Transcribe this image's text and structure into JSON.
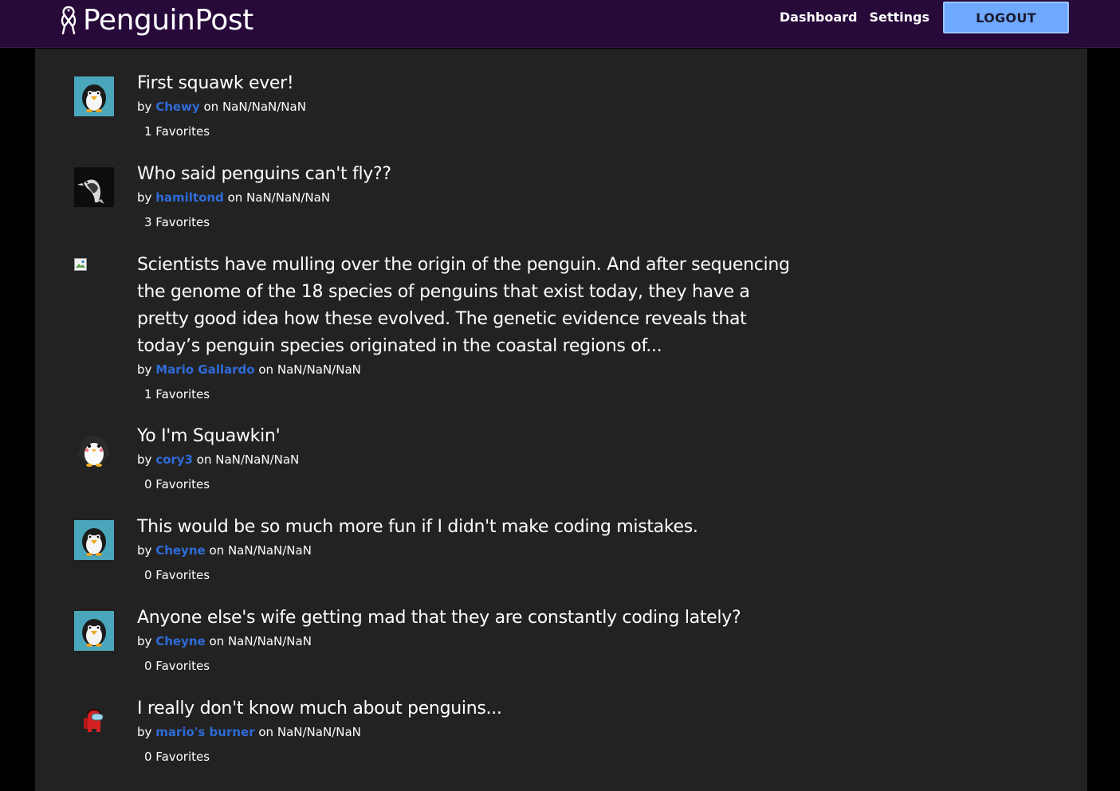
{
  "app": {
    "logo_text": "PenguinPost"
  },
  "nav": {
    "dashboard": "Dashboard",
    "settings": "Settings",
    "logout": "LOGOUT"
  },
  "posts": [
    {
      "title": "First squawk ever!",
      "by": "by",
      "author": "Chewy",
      "on": "on",
      "date": "NaN/NaN/NaN",
      "favorites": "1 Favorites",
      "avatar_icon": "penguin-avatar-icon"
    },
    {
      "title": "Who said penguins can't fly??",
      "by": "by",
      "author": "hamiltond",
      "on": "on",
      "date": "NaN/NaN/NaN",
      "favorites": "3 Favorites",
      "avatar_icon": "bird-photo-icon"
    },
    {
      "title": "Scientists have mulling over the origin of the penguin. And after sequencing the genome of the 18 species of penguins that exist today, they have a pretty good idea how these evolved. The genetic evidence reveals that today’s penguin species originated in the coastal regions of...",
      "by": "by",
      "author": "Mario Gallardo",
      "on": "on",
      "date": "NaN/NaN/NaN",
      "favorites": "1 Favorites",
      "avatar_icon": "broken-image-icon"
    },
    {
      "title": "Yo I'm Squawkin'",
      "by": "by",
      "author": "cory3",
      "on": "on",
      "date": "NaN/NaN/NaN",
      "favorites": "0 Favorites",
      "avatar_icon": "penguin-cartoon-icon"
    },
    {
      "title": "This would be so much more fun if I didn't make coding mistakes.",
      "by": "by",
      "author": "Cheyne",
      "on": "on",
      "date": "NaN/NaN/NaN",
      "favorites": "0 Favorites",
      "avatar_icon": "penguin-avatar-icon"
    },
    {
      "title": "Anyone else's wife getting mad that they are constantly coding lately?",
      "by": "by",
      "author": "Cheyne",
      "on": "on",
      "date": "NaN/NaN/NaN",
      "favorites": "0 Favorites",
      "avatar_icon": "penguin-avatar-icon"
    },
    {
      "title": "I really don't know much about penguins...",
      "by": "by",
      "author": "mario's burner",
      "on": "on",
      "date": "NaN/NaN/NaN",
      "favorites": "0 Favorites",
      "avatar_icon": "crewmate-icon"
    }
  ],
  "colors": {
    "navbar_bg": "#27093a",
    "content_bg": "#222222",
    "author_link": "#2f6bd8",
    "logout_bg": "#6fa8ff"
  }
}
